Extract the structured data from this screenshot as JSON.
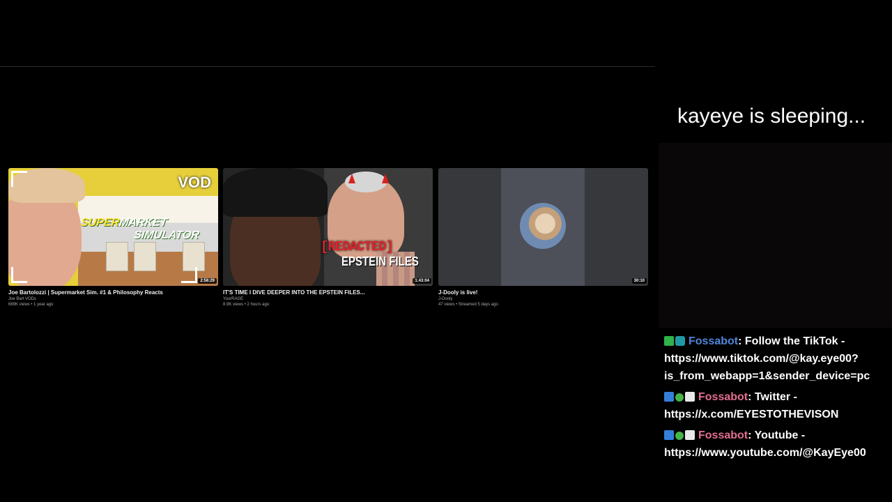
{
  "videos": [
    {
      "title": "Joe Bartolozzi | Supermarket Sim. #1 & Philosophy Reacts",
      "channel": "Joe Bart VODs",
      "meta": "689K views • 1 year ago",
      "duration": "2:56:29",
      "thumb_text": {
        "vod": "VOD",
        "line1_a": "SUPER",
        "line1_b": "MARKET",
        "line2": "SIMULATOR"
      }
    },
    {
      "title": "IT'S TIME I DIVE DEEPER INTO THE EPSTEIN FILES...",
      "channel": "YourRAGE",
      "meta": "8.9K views • 2 hours ago",
      "duration": "1:43:04",
      "thumb_text": {
        "redacted": "[REDACTED]",
        "epstein": "EPSTEIN FILES"
      }
    },
    {
      "title": "J-Dooly is live!",
      "channel": "J-Dooly",
      "meta": "47 views • Streamed 5 days ago",
      "duration": "30:10"
    }
  ],
  "stream_status": "kayeye is sleeping...",
  "chat": [
    {
      "badges": [
        "pencil-badge-icon",
        "bot-badge-icon"
      ],
      "user": "Fossabot",
      "user_color": "#4f86d9",
      "text": ": Follow the TikTok - https://www.tiktok.com/@kay.eye00?is_from_webapp=1&sender_device=pc"
    },
    {
      "badges": [
        "hammer-badge-icon",
        "verified-badge-icon",
        "eye-badge-icon"
      ],
      "user": "Fossabot",
      "user_color": "#e36d8f",
      "text": ": Twitter - https://x.com/EYESTOTHEVISON"
    },
    {
      "badges": [
        "hammer-badge-icon",
        "verified-badge-icon",
        "eye-badge-icon"
      ],
      "user": "Fossabot",
      "user_color": "#e36d8f",
      "text": ": Youtube - https://www.youtube.com/@KayEye00"
    }
  ]
}
